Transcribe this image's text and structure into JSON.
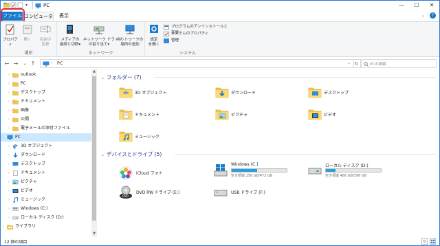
{
  "window": {
    "title": "PC"
  },
  "titlebar": {
    "minimize": "—",
    "maximize": "☐",
    "close": "✕"
  },
  "tabs": [
    {
      "label": "ファイル"
    },
    {
      "label": "コンピューター"
    },
    {
      "label": "表示"
    }
  ],
  "ribbon": {
    "groups": [
      {
        "label": "場所",
        "buttons": [
          {
            "label": "プロパティ"
          },
          {
            "label": "開く"
          },
          {
            "label": "名前の\n変更"
          }
        ]
      },
      {
        "label": "ネットワーク",
        "buttons": [
          {
            "label": "メディアの\n接続と切断▾"
          },
          {
            "label": "ネットワーク ドライブ\nの割り当て▾"
          },
          {
            "label": "ネットワークの\n場所の追加"
          }
        ]
      },
      {
        "label": "システム",
        "buttons": [
          {
            "label": "設定\nを開く"
          }
        ],
        "small": [
          {
            "label": "プログラムのアンインストールと変更"
          },
          {
            "label": "システムのプロパティ"
          },
          {
            "label": "管理"
          }
        ]
      }
    ]
  },
  "address": {
    "back": "←",
    "forward": "→",
    "recent": "⌄",
    "up": "↑",
    "path": "PC",
    "refresh": "↻",
    "search_placeholder": "PCの検索"
  },
  "nav": {
    "items": [
      {
        "label": "outlook",
        "icon": "folder-icon",
        "depth": 1
      },
      {
        "label": "PC",
        "icon": "folder-icon",
        "depth": 1
      },
      {
        "label": "デスクトップ",
        "icon": "folder-icon",
        "depth": 1
      },
      {
        "label": "ドキュメント",
        "icon": "folder-icon",
        "depth": 1
      },
      {
        "label": "画像",
        "icon": "folder-icon",
        "depth": 1
      },
      {
        "label": "公開",
        "icon": "folder-icon",
        "depth": 1
      },
      {
        "label": "電子メールの添付ファイル",
        "icon": "folder-icon",
        "depth": 1
      },
      {
        "label": "PC",
        "icon": "pc-icon",
        "depth": 0,
        "selected": true,
        "expanded": true
      },
      {
        "label": "3D オブジェクト",
        "icon": "3d-objects-icon",
        "depth": 1
      },
      {
        "label": "ダウンロード",
        "icon": "download-icon",
        "depth": 1
      },
      {
        "label": "デスクトップ",
        "icon": "desktop-icon",
        "depth": 1
      },
      {
        "label": "ドキュメント",
        "icon": "documents-icon",
        "depth": 1
      },
      {
        "label": "ピクチャ",
        "icon": "pictures-icon",
        "depth": 1
      },
      {
        "label": "ビデオ",
        "icon": "video-icon",
        "depth": 1
      },
      {
        "label": "ミュージック",
        "icon": "music-icon",
        "depth": 1
      },
      {
        "label": "Windows (C:)",
        "icon": "windows-drive-icon",
        "depth": 1
      },
      {
        "label": "ローカル ディスク (D:)",
        "icon": "drive-icon",
        "depth": 1
      },
      {
        "label": "ライブラリ",
        "icon": "library-icon",
        "depth": 0
      }
    ]
  },
  "content": {
    "folders_header": "フォルダー (7)",
    "folders": [
      {
        "label": "3D オブジェクト",
        "icon": "3d-objects-folder-icon"
      },
      {
        "label": "ダウンロード",
        "icon": "download-folder-icon"
      },
      {
        "label": "デスクトップ",
        "icon": "desktop-folder-icon"
      },
      {
        "label": "ドキュメント",
        "icon": "documents-folder-icon"
      },
      {
        "label": "ピクチャ",
        "icon": "pictures-folder-icon"
      },
      {
        "label": "ビデオ",
        "icon": "video-folder-icon"
      },
      {
        "label": "ミュージック",
        "icon": "music-folder-icon"
      }
    ],
    "drives_header": "デバイスとドライブ (5)",
    "drives": [
      {
        "label": "iCloud フォト",
        "icon": "icloud-photos-icon"
      },
      {
        "label": "Windows (C:)",
        "icon": "windows-drive-icon",
        "free": "空き領域 256 GB/472 GB",
        "used_fraction": 0.46
      },
      {
        "label": "ローカル ディスク (D:)",
        "icon": "drive-icon",
        "free": "空き領域 486 GB/596 GB",
        "used_fraction": 0.18
      },
      {
        "label": "DVD RW ドライブ (E:)",
        "icon": "dvd-drive-icon"
      },
      {
        "label": "USB ドライブ (F:)",
        "icon": "usb-drive-icon"
      }
    ]
  },
  "status": {
    "text": "12 個の項目"
  },
  "colors": {
    "accent": "#1979ca",
    "highlight_ring": "#d9233f",
    "selection": "#cce8ff",
    "bar_fill": "#26a0da"
  }
}
